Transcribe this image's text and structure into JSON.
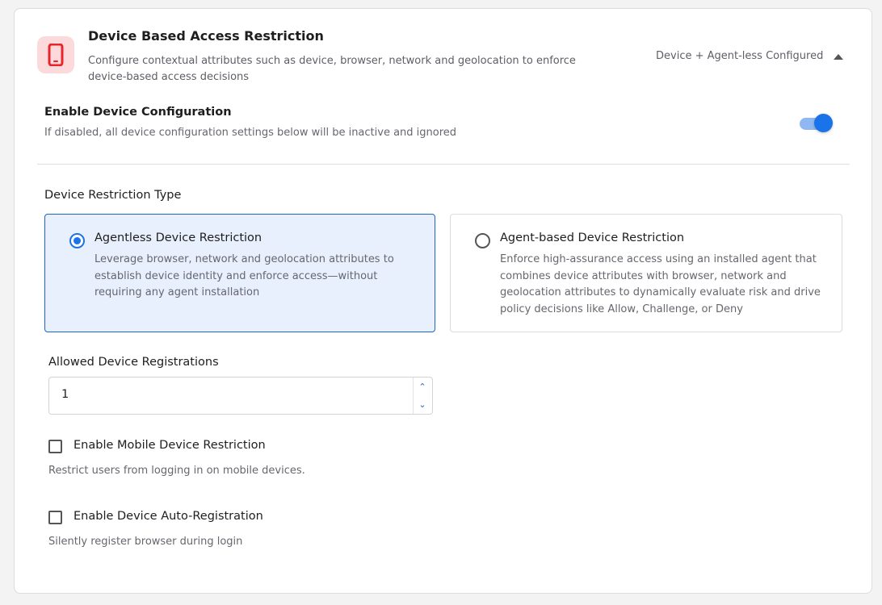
{
  "header": {
    "icon": "mobile-device-icon",
    "icon_color": "#e8262a",
    "title": "Device Based Access Restriction",
    "description": "Configure contextual attributes such as device, browser, network and geolocation to enforce device-based access decisions",
    "status": "Device + Agent-less Configured",
    "expanded": true
  },
  "device_config": {
    "title": "Enable Device Configuration",
    "description": "If disabled, all device configuration settings below will be inactive and ignored",
    "enabled": true
  },
  "restriction_type": {
    "label": "Device Restriction Type",
    "options": [
      {
        "title": "Agentless Device Restriction",
        "description": "Leverage browser, network and geolocation attributes to establish device identity and enforce access—without requiring any agent installation",
        "selected": true
      },
      {
        "title": "Agent-based Device Restriction",
        "description": "Enforce high-assurance access using an installed agent that combines device attributes with browser, network and geolocation attributes to dynamically evaluate risk and drive policy decisions like Allow, Challenge, or Deny",
        "selected": false
      }
    ]
  },
  "registrations": {
    "label": "Allowed Device Registrations",
    "value": "1"
  },
  "mobile_restriction": {
    "label": "Enable Mobile Device Restriction",
    "description": "Restrict users from logging in on mobile devices.",
    "checked": false
  },
  "auto_registration": {
    "label": "Enable Device Auto-Registration",
    "description": "Silently register browser during login",
    "checked": false
  },
  "colors": {
    "accent": "#1a73e8",
    "selected_bg": "#e8f0fd",
    "icon_bg": "#fcd9da"
  }
}
